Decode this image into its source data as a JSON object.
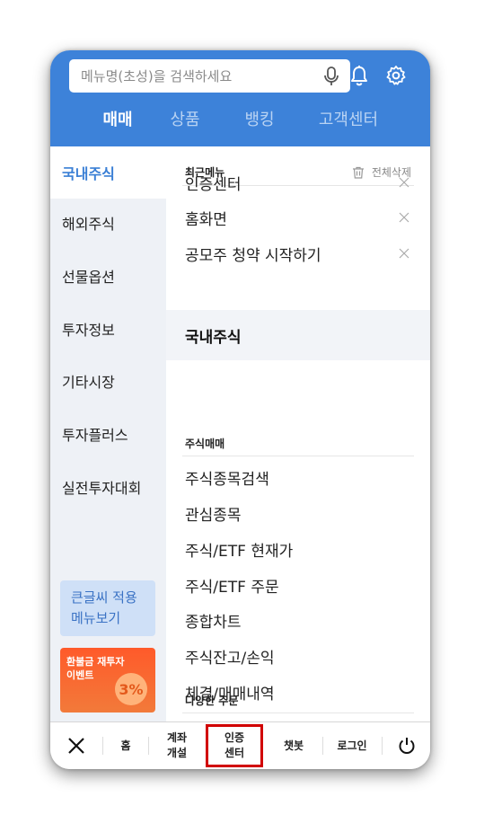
{
  "search": {
    "placeholder": "메뉴명(초성)을 검색하세요"
  },
  "header": {
    "icons": [
      "mic-icon",
      "bell-icon",
      "gear-icon"
    ],
    "tabs": [
      {
        "label": "매매",
        "active": true
      },
      {
        "label": "상품",
        "active": false
      },
      {
        "label": "뱅킹",
        "active": false
      },
      {
        "label": "고객센터",
        "active": false
      }
    ]
  },
  "sidebar": {
    "items": [
      {
        "label": "국내주식",
        "active": true
      },
      {
        "label": "해외주식",
        "active": false
      },
      {
        "label": "선물옵션",
        "active": false
      },
      {
        "label": "투자정보",
        "active": false
      },
      {
        "label": "기타시장",
        "active": false
      },
      {
        "label": "투자플러스",
        "active": false
      },
      {
        "label": "실전투자대회",
        "active": false
      }
    ],
    "big_font_button": {
      "line1": "큰글씨 적용",
      "line2": "메뉴보기"
    },
    "event_banner": {
      "line1": "환불금 재투자",
      "line2": "이벤트",
      "badge": "3%"
    }
  },
  "recent": {
    "title": "최근메뉴",
    "delete_all": "전체삭제",
    "items": [
      "인증센터",
      "홈화면",
      "공모주 청약 시작하기"
    ]
  },
  "category": {
    "title": "국내주식"
  },
  "stock_trading": {
    "title": "주식매매",
    "items": [
      "주식종목검색",
      "관심종목",
      "주식/ETF 현재가",
      "주식/ETF 주문",
      "종합차트",
      "주식잔고/손익",
      "체결/매매내역"
    ]
  },
  "various_orders": {
    "title": "다양한 주문"
  },
  "bottom_bar": {
    "home": "홈",
    "account_open": {
      "line1": "계좌",
      "line2": "개설"
    },
    "cert_center": {
      "line1": "인증",
      "line2": "센터"
    },
    "chatbot": "챗봇",
    "login": "로그인"
  },
  "colors": {
    "brand_blue": "#3d82d9",
    "active_side": "#3a7fd5",
    "highlight_red": "#d10000",
    "event_orange": "#ff5a2a"
  }
}
